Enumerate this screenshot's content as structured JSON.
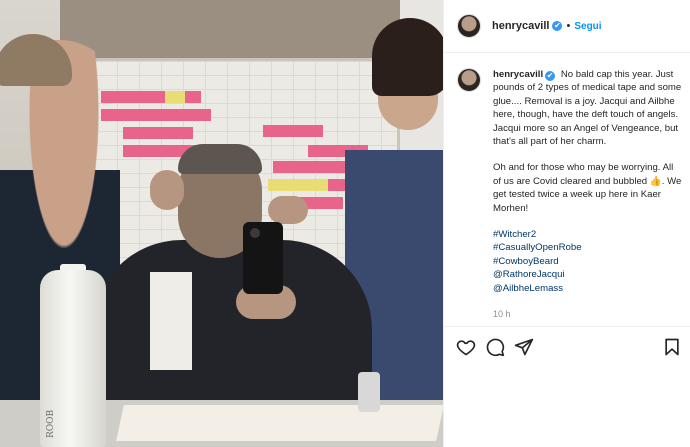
{
  "post": {
    "username": "henrycavill",
    "verified_badge": "✔",
    "separator": "•",
    "follow_label": "Segui"
  },
  "photo": {
    "bottle_text": "ROOB"
  },
  "caption": {
    "username": "henrycavill",
    "verified_badge": "✔",
    "paragraph1": "No bald cap this year. Just pounds of 2 types of medical tape and some glue.... Removal is a joy. Jacqui and Ailbhe here, though, have the deft touch of angels. Jacqui more so an Angel of Vengeance, but that's all part of her charm.",
    "paragraph2_before": "Oh and for those who may be worrying. All of us are Covid cleared and bubbled ",
    "paragraph2_emoji": "👍",
    "paragraph2_after": ". We get tested twice a week up here in Kaer Morhen!",
    "tags": [
      "#Witcher2",
      "#CasuallyOpenRobe",
      "#CowboyBeard",
      "@RathoreJacqui",
      "@AilbheLemass"
    ],
    "overflow_text": "10 h"
  },
  "actions": {
    "like_icon": "heart-icon",
    "comment_icon": "comment-icon",
    "share_icon": "share-icon",
    "save_icon": "bookmark-icon"
  },
  "colors": {
    "link": "#00376b",
    "follow": "#0095f6",
    "verified": "#3897f0"
  }
}
